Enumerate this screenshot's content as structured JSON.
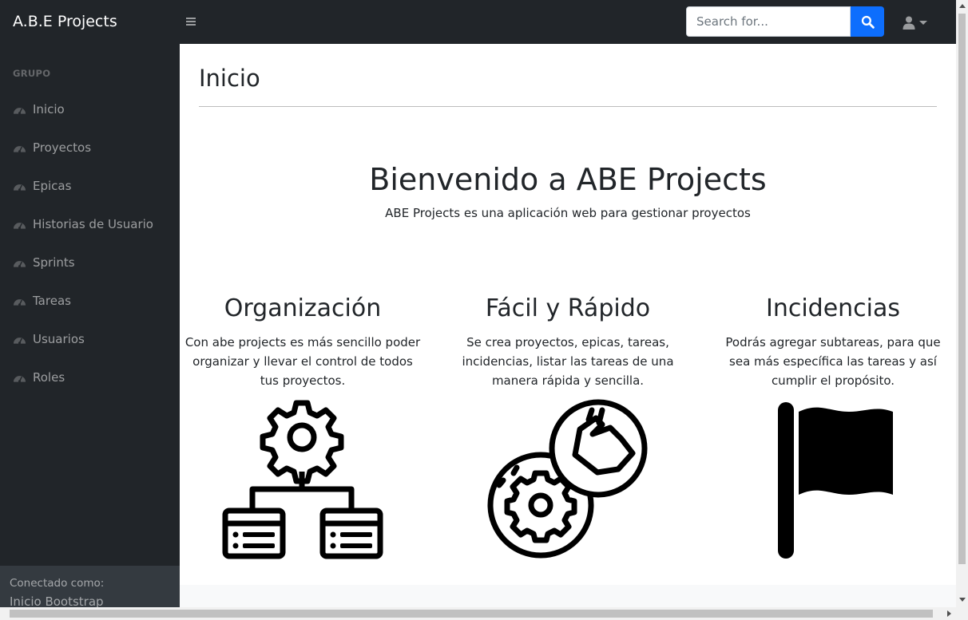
{
  "navbar": {
    "brand": "A.B.E Projects",
    "search_placeholder": "Search for...",
    "toggle_icon": "menu-icon",
    "search_icon": "search-icon",
    "user_icon": "user-icon"
  },
  "sidebar": {
    "heading": "GRUPO",
    "items": [
      {
        "label": "Inicio",
        "icon": "tachometer-icon"
      },
      {
        "label": "Proyectos",
        "icon": "tachometer-icon"
      },
      {
        "label": "Epicas",
        "icon": "tachometer-icon"
      },
      {
        "label": "Historias de Usuario",
        "icon": "tachometer-icon"
      },
      {
        "label": "Sprints",
        "icon": "tachometer-icon"
      },
      {
        "label": "Tareas",
        "icon": "tachometer-icon"
      },
      {
        "label": "Usuarios",
        "icon": "tachometer-icon"
      },
      {
        "label": "Roles",
        "icon": "tachometer-icon"
      }
    ],
    "footer": {
      "label": "Conectado como:",
      "user": "Inicio Bootstrap"
    }
  },
  "main": {
    "page_title": "Inicio",
    "hero_title": "Bienvenido a ABE Projects",
    "hero_subtitle": "ABE Projects es una aplicación web para gestionar proyectos",
    "features": [
      {
        "title": "Organización",
        "text": "Con abe projects es más sencillo poder organizar y llevar el control de todos tus proyectos.",
        "icon": "gear-hierarchy-icon"
      },
      {
        "title": "Fácil y Rápido",
        "text": "Se crea proyectos, epicas, tareas, incidencias, listar las tareas de una manera rápida y sencilla.",
        "icon": "gear-hand-icon"
      },
      {
        "title": "Incidencias",
        "text": "Podrás agregar subtareas, para que sea más específica las tareas y así cumplir el propósito.",
        "icon": "flag-icon"
      }
    ]
  },
  "colors": {
    "dark": "#212529",
    "primary": "#0d6efd",
    "sidebar_footer": "#343a40"
  }
}
